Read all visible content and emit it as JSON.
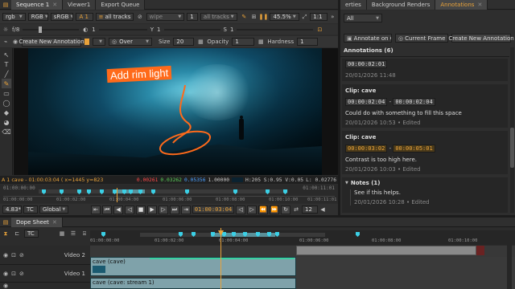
{
  "left_tabs": [
    {
      "label": "Sequence 1",
      "active": true
    },
    {
      "label": "Viewer1",
      "active": false
    },
    {
      "label": "Export Queue",
      "active": false
    }
  ],
  "right_tabs": [
    {
      "label": "erties"
    },
    {
      "label": "Background Renders"
    },
    {
      "label": "Annotations",
      "active": true
    }
  ],
  "viewer_bar1": {
    "channel": "rgb",
    "colorspace": "RGB",
    "lut": "sRGB",
    "a_label": "A",
    "a_num": "1",
    "tracks_a": "all tracks",
    "b_value": "wipe",
    "b_num": "1",
    "tracks_b": "all tracks",
    "zoom": "45.5%",
    "ratio": "1:1"
  },
  "viewer_bar2": {
    "fstop": "f/8",
    "frame": "1",
    "y": "Y",
    "y_val": "1",
    "s": "S",
    "s_val": "1"
  },
  "ann_bar": {
    "create_label": "Create New Annotation",
    "blend": "Over",
    "size_label": "Size",
    "size_val": "20",
    "opacity_label": "Opacity",
    "opacity_val": "1",
    "hardness_label": "Hardness",
    "hardness_val": "1"
  },
  "canvas": {
    "annotation_text": "Add rim light"
  },
  "viewer_info": {
    "label": "A 1 cave - 01:00:03:04 ( x=1445 y=823",
    "r": "0.00261",
    "g": "0.03262",
    "b": "0.05356",
    "a": "1.00000",
    "hsv": "H:205 S:0.95 V:0.05",
    "l": "L: 0.02776"
  },
  "mini_timeline": {
    "tc_left": "01:00:00:00",
    "tc_right": "01:00:11:01",
    "ticks": [
      "01:00:00:00",
      "01:00:02:00",
      "01:00:04:00",
      "01:00:06:00",
      "01:00:08:00",
      "01:00:10:00"
    ],
    "end_tc": "01:00:11:01"
  },
  "transport": {
    "zoom": "4.83*",
    "tc_label": "TC",
    "global": "Global",
    "current": "01:00:03:04",
    "fps_val": "12"
  },
  "right_panel": {
    "filter": "All",
    "ann_on": "Annotate on C",
    "frame_mode": "Current Frame",
    "create_label": "Create New Annotation",
    "section_title": "Annotations (6)",
    "partial_tc": "00:00:02:01",
    "partial_meta": "20/01/2026 11:48",
    "clips": [
      {
        "title": "Clip: cave",
        "tc_in": "00:00:02:04",
        "tc_out": "00:00:02:04",
        "note": "Could do with something to fill this space",
        "meta": "20/01/2026 10:53 • Edited",
        "highlight": false
      },
      {
        "title": "Clip: cave",
        "tc_in": "00:00:03:02",
        "tc_out": "00:00:05:01",
        "note": "Contrast is too high here.",
        "meta": "20/01/2026 10:03 • Edited",
        "highlight": true
      }
    ],
    "notes_title": "Notes (1)",
    "note_text": "See if this helps.",
    "note_meta": "20/01/2026 10:28 • Edited"
  },
  "dope_sheet": {
    "tab": "Dope Sheet",
    "tc_label": "TC",
    "ticks": [
      "01:00:00:00",
      "01:00:02:00",
      "01:00:04:00",
      "01:00:06:00",
      "01:00:08:00",
      "01:00:10:00"
    ]
  },
  "tracks": [
    {
      "name": "Video 2"
    },
    {
      "name": "Video 1"
    }
  ],
  "clips": [
    {
      "label": "cave (cave)"
    },
    {
      "label": "cave (cave: stream 1)"
    }
  ],
  "colors": {
    "accent": "#e8a23a",
    "keyframe": "#3bd0e6",
    "annotation": "#ff6a1a",
    "clip": "#5a8f98"
  }
}
